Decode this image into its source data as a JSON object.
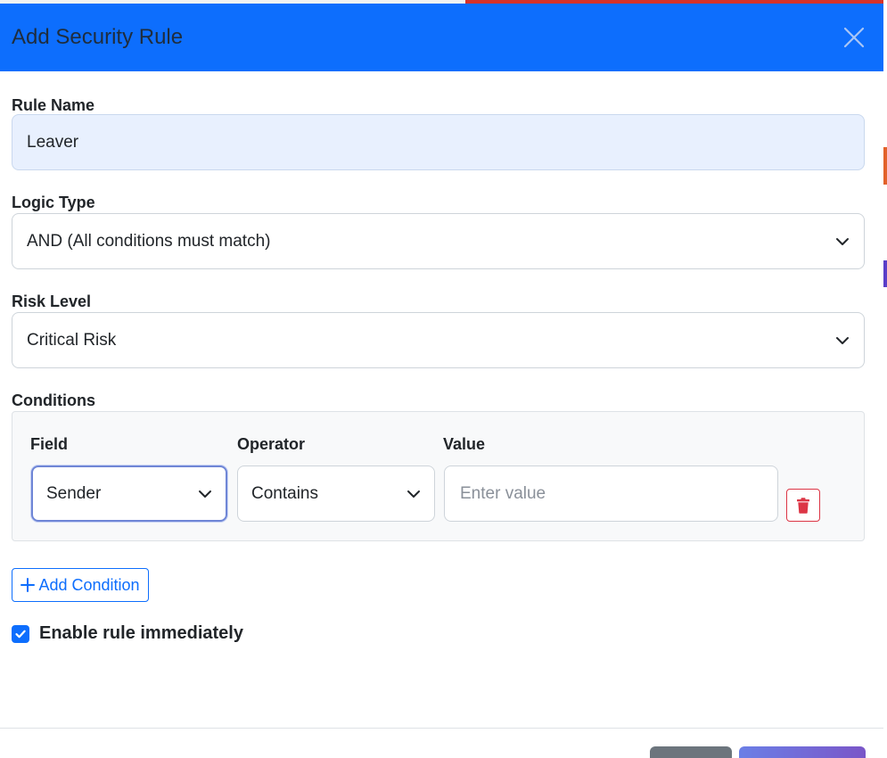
{
  "modal": {
    "title": "Add Security Rule",
    "close_icon": "close-icon"
  },
  "rule_name": {
    "label": "Rule Name",
    "value": "Leaver"
  },
  "logic_type": {
    "label": "Logic Type",
    "selected": "AND (All conditions must match)"
  },
  "risk_level": {
    "label": "Risk Level",
    "selected": "Critical Risk"
  },
  "conditions": {
    "label": "Conditions",
    "columns": {
      "field": "Field",
      "operator": "Operator",
      "value": "Value"
    },
    "rows": [
      {
        "field": "Sender",
        "operator": "Contains",
        "value": "",
        "value_placeholder": "Enter value"
      }
    ],
    "delete_icon": "trash-icon"
  },
  "add_condition": {
    "label": "Add Condition",
    "icon": "plus-icon"
  },
  "enable_rule": {
    "label": "Enable rule immediately",
    "checked": true
  },
  "colors": {
    "header_bg": "#0d6efd",
    "primary": "#0d6efd",
    "danger": "#dc3545",
    "secondary": "#6c757d"
  }
}
